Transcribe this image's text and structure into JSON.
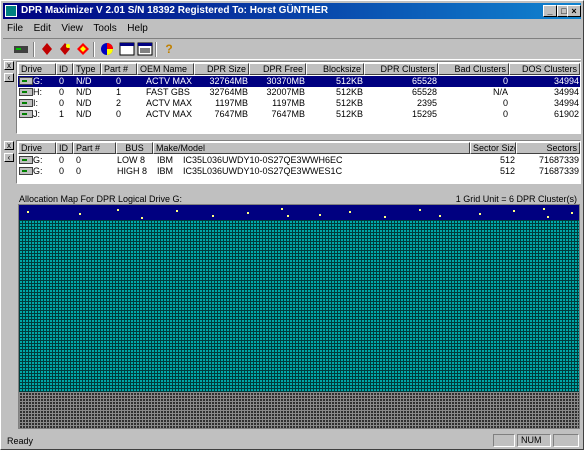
{
  "window": {
    "title": "DPR Maximizer V 2.01  S/N 18392  Registered To: Horst GÜNTHER"
  },
  "menu": {
    "items": [
      "File",
      "Edit",
      "View",
      "Tools",
      "Help"
    ]
  },
  "toolbar": {
    "icons": [
      "drive-icon",
      "red-diamond-icon",
      "red-yellow-icon",
      "red-gem-icon",
      "pie-icon",
      "window-icon",
      "display-icon",
      "help-icon"
    ]
  },
  "drives_table": {
    "columns": [
      "Drive",
      "ID",
      "Type",
      "Part #",
      "OEM Name",
      "DPR Size",
      "DPR Free",
      "Blocksize",
      "DPR Clusters",
      "Bad Clusters",
      "DOS Clusters"
    ],
    "rows": [
      {
        "drive": "G:",
        "id": "0",
        "type": "N/D",
        "part": "0",
        "oem": "ACTV MAX",
        "size": "32764MB",
        "free": "30370MB",
        "block": "512KB",
        "clusters": "65528",
        "bad": "0",
        "dos": "34994"
      },
      {
        "drive": "H:",
        "id": "0",
        "type": "N/D",
        "part": "1",
        "oem": "FAST GBS",
        "size": "32764MB",
        "free": "32007MB",
        "block": "512KB",
        "clusters": "65528",
        "bad": "N/A",
        "dos": "34994"
      },
      {
        "drive": "I:",
        "id": "0",
        "type": "N/D",
        "part": "2",
        "oem": "ACTV MAX",
        "size": "1197MB",
        "free": "1197MB",
        "block": "512KB",
        "clusters": "2395",
        "bad": "0",
        "dos": "34994"
      },
      {
        "drive": "J:",
        "id": "1",
        "type": "N/D",
        "part": "0",
        "oem": "ACTV MAX",
        "size": "7647MB",
        "free": "7647MB",
        "block": "512KB",
        "clusters": "15295",
        "bad": "0",
        "dos": "61902"
      }
    ]
  },
  "devices_table": {
    "columns": [
      "Drive",
      "ID",
      "Part #",
      "BUS",
      "Make/Model",
      "Sector Size",
      "Sectors"
    ],
    "rows": [
      {
        "drive": "G:",
        "id": "0",
        "part": "0",
        "bus": "LOW 8",
        "make": "IBM",
        "model": "IC35L036UWDY10-0S27QE3WWH6EC",
        "ss": "512",
        "sectors": "71687339"
      },
      {
        "drive": "G:",
        "id": "0",
        "part": "0",
        "bus": "HIGH 8",
        "make": "IBM",
        "model": "IC35L036UWDY10-0S27QE3WWES1C",
        "ss": "512",
        "sectors": "71687339"
      }
    ]
  },
  "map": {
    "title": "Allocation Map For DPR Logical Drive G:",
    "unit": "1 Grid Unit = 6 DPR Cluster(s)"
  },
  "status": {
    "text": "Ready",
    "num": "NUM"
  },
  "colors": {
    "selection": "#000080",
    "used": "#000080",
    "free": "#00a8a8",
    "unused": "#303030"
  }
}
